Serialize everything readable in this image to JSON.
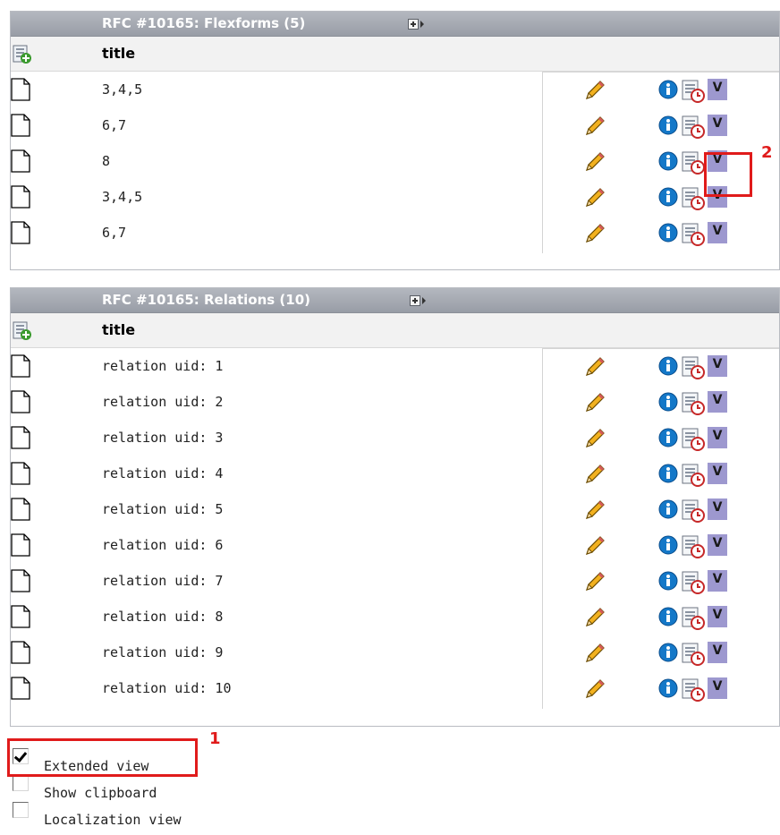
{
  "panels": [
    {
      "title": "RFC #10165: Flexforms (5)",
      "column_title": "title",
      "rows": [
        {
          "title": "3,4,5"
        },
        {
          "title": "6,7"
        },
        {
          "title": "8"
        },
        {
          "title": "3,4,5"
        },
        {
          "title": "6,7"
        }
      ]
    },
    {
      "title": "RFC #10165: Relations (10)",
      "column_title": "title",
      "rows": [
        {
          "title": "relation uid: 1"
        },
        {
          "title": "relation uid: 2"
        },
        {
          "title": "relation uid: 3"
        },
        {
          "title": "relation uid: 4"
        },
        {
          "title": "relation uid: 5"
        },
        {
          "title": "relation uid: 6"
        },
        {
          "title": "relation uid: 7"
        },
        {
          "title": "relation uid: 8"
        },
        {
          "title": "relation uid: 9"
        },
        {
          "title": "relation uid: 10"
        }
      ]
    }
  ],
  "row_actions": {
    "edit_icon": "pencil-icon",
    "info_icon": "info-icon",
    "history_icon": "history-icon",
    "move_label": "V"
  },
  "options": [
    {
      "label": "Extended view",
      "checked": true
    },
    {
      "label": "Show clipboard",
      "checked": false
    },
    {
      "label": "Localization view",
      "checked": false
    }
  ],
  "annotations": [
    {
      "label": "1"
    },
    {
      "label": "2"
    }
  ],
  "colors": {
    "header_bg": "#a7abb2",
    "move_button": "#9d98cf",
    "highlight": "#e01b1b",
    "info_blue": "#1478c8"
  }
}
